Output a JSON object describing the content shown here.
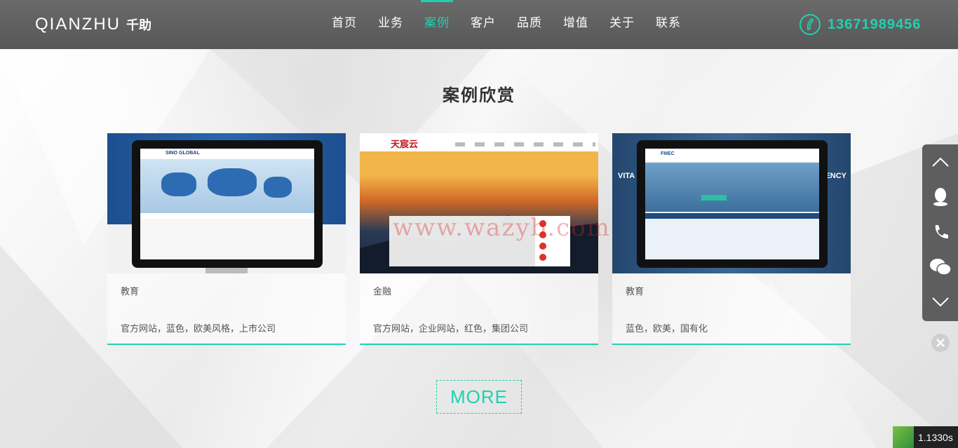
{
  "header": {
    "logo_latin": "QIANZHU",
    "logo_cn": "千助",
    "nav": [
      {
        "label": "首页",
        "active": false
      },
      {
        "label": "业务",
        "active": false
      },
      {
        "label": "案例",
        "active": true
      },
      {
        "label": "客户",
        "active": false
      },
      {
        "label": "品质",
        "active": false
      },
      {
        "label": "增值",
        "active": false
      },
      {
        "label": "关于",
        "active": false
      },
      {
        "label": "联系",
        "active": false
      }
    ],
    "phone_number": "13671989456"
  },
  "section": {
    "title": "案例欣赏",
    "cards": [
      {
        "category": "教育",
        "tags": "官方网站，蓝色，欧美风格，上市公司",
        "thumb_text": "SINO GLOBAL"
      },
      {
        "category": "金融",
        "tags": "官方网站，企业网站，红色，集团公司",
        "thumb_text": "天宸云"
      },
      {
        "category": "教育",
        "tags": "蓝色，欧美，国有化",
        "thumb_text": "FMEC",
        "side_left": "VITA",
        "side_right": "ENCY"
      }
    ],
    "more_label": "MORE"
  },
  "watermark": "www.wazyb.com",
  "side_float": {
    "items": [
      "back-to-top-icon",
      "qq-icon",
      "phone-icon",
      "wechat-icon",
      "scroll-down-icon"
    ]
  },
  "timer": "1.1330s",
  "colors": {
    "accent": "#1fd1b0",
    "header_bg": "#5f5f5f"
  }
}
